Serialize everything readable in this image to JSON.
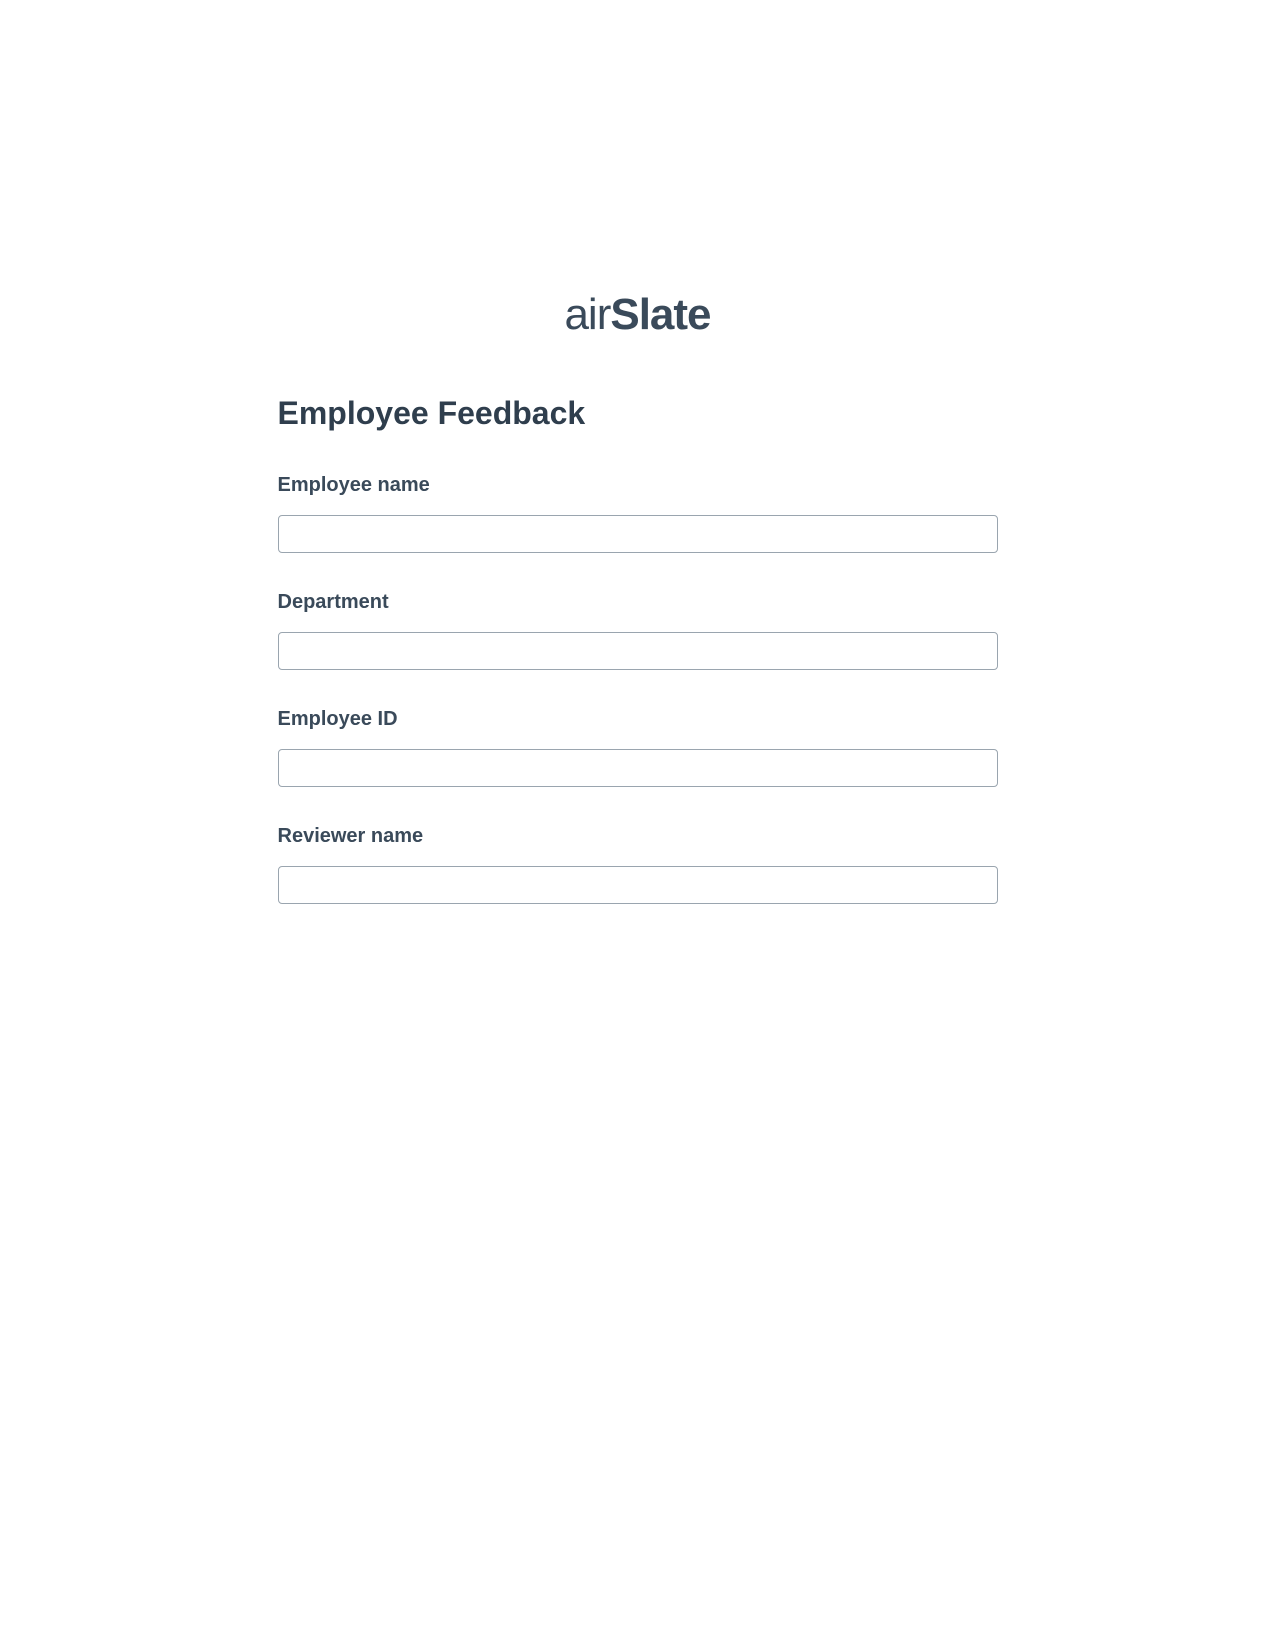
{
  "logo": {
    "part1": "air",
    "part2": "Slate"
  },
  "form": {
    "title": "Employee Feedback",
    "fields": [
      {
        "label": "Employee name",
        "value": ""
      },
      {
        "label": "Department",
        "value": ""
      },
      {
        "label": "Employee ID",
        "value": ""
      },
      {
        "label": "Reviewer name",
        "value": ""
      }
    ]
  }
}
